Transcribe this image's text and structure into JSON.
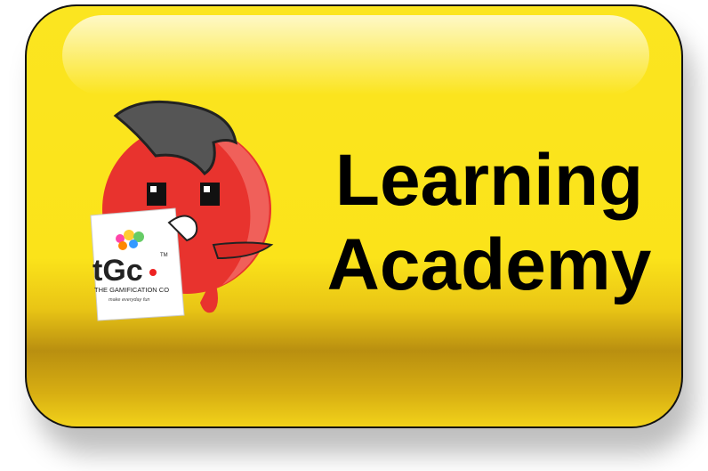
{
  "button": {
    "line1": "Learning",
    "line2": "Academy",
    "color": "#fbe31a"
  },
  "logo": {
    "mark": "tGc",
    "trademark": "TM",
    "name": "THE GAMIFICATION CO",
    "tagline": "make everyday fun"
  }
}
